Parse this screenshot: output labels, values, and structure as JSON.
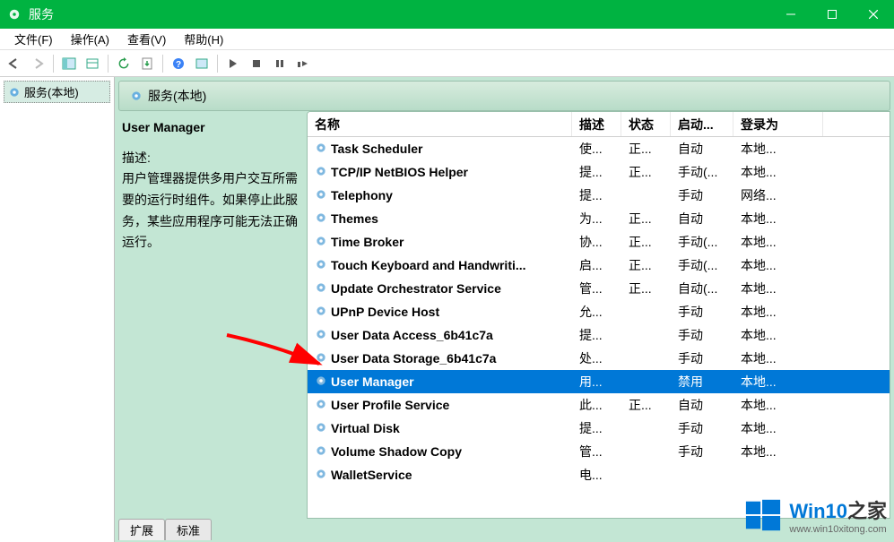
{
  "window": {
    "title": "服务"
  },
  "menubar": {
    "file": "文件(F)",
    "action": "操作(A)",
    "view": "查看(V)",
    "help": "帮助(H)"
  },
  "nav": {
    "local_services": "服务(本地)"
  },
  "content_header": "服务(本地)",
  "detail": {
    "service_name": "User Manager",
    "desc_label": "描述:",
    "desc_text": "用户管理器提供多用户交互所需要的运行时组件。如果停止此服务，某些应用程序可能无法正确运行。"
  },
  "columns": {
    "name": "名称",
    "desc": "描述",
    "status": "状态",
    "startup": "启动...",
    "logon": "登录为"
  },
  "services": [
    {
      "name": "Task Scheduler",
      "desc": "使...",
      "status": "正...",
      "startup": "自动",
      "logon": "本地..."
    },
    {
      "name": "TCP/IP NetBIOS Helper",
      "desc": "提...",
      "status": "正...",
      "startup": "手动(...",
      "logon": "本地..."
    },
    {
      "name": "Telephony",
      "desc": "提...",
      "status": "",
      "startup": "手动",
      "logon": "网络..."
    },
    {
      "name": "Themes",
      "desc": "为...",
      "status": "正...",
      "startup": "自动",
      "logon": "本地..."
    },
    {
      "name": "Time Broker",
      "desc": "协...",
      "status": "正...",
      "startup": "手动(...",
      "logon": "本地..."
    },
    {
      "name": "Touch Keyboard and Handwriti...",
      "desc": "启...",
      "status": "正...",
      "startup": "手动(...",
      "logon": "本地..."
    },
    {
      "name": "Update Orchestrator Service",
      "desc": "管...",
      "status": "正...",
      "startup": "自动(...",
      "logon": "本地..."
    },
    {
      "name": "UPnP Device Host",
      "desc": "允...",
      "status": "",
      "startup": "手动",
      "logon": "本地..."
    },
    {
      "name": "User Data Access_6b41c7a",
      "desc": "提...",
      "status": "",
      "startup": "手动",
      "logon": "本地..."
    },
    {
      "name": "User Data Storage_6b41c7a",
      "desc": "处...",
      "status": "",
      "startup": "手动",
      "logon": "本地..."
    },
    {
      "name": "User Manager",
      "desc": "用...",
      "status": "",
      "startup": "禁用",
      "logon": "本地...",
      "selected": true
    },
    {
      "name": "User Profile Service",
      "desc": "此...",
      "status": "正...",
      "startup": "自动",
      "logon": "本地..."
    },
    {
      "name": "Virtual Disk",
      "desc": "提...",
      "status": "",
      "startup": "手动",
      "logon": "本地..."
    },
    {
      "name": "Volume Shadow Copy",
      "desc": "管...",
      "status": "",
      "startup": "手动",
      "logon": "本地..."
    },
    {
      "name": "WalletService",
      "desc": "电...",
      "status": "",
      "startup": "",
      "logon": ""
    }
  ],
  "tabs": {
    "extended": "扩展",
    "standard": "标准"
  },
  "watermark": {
    "brand_en": "Win10",
    "brand_zh": "之家",
    "url": "www.win10xitong.com"
  }
}
